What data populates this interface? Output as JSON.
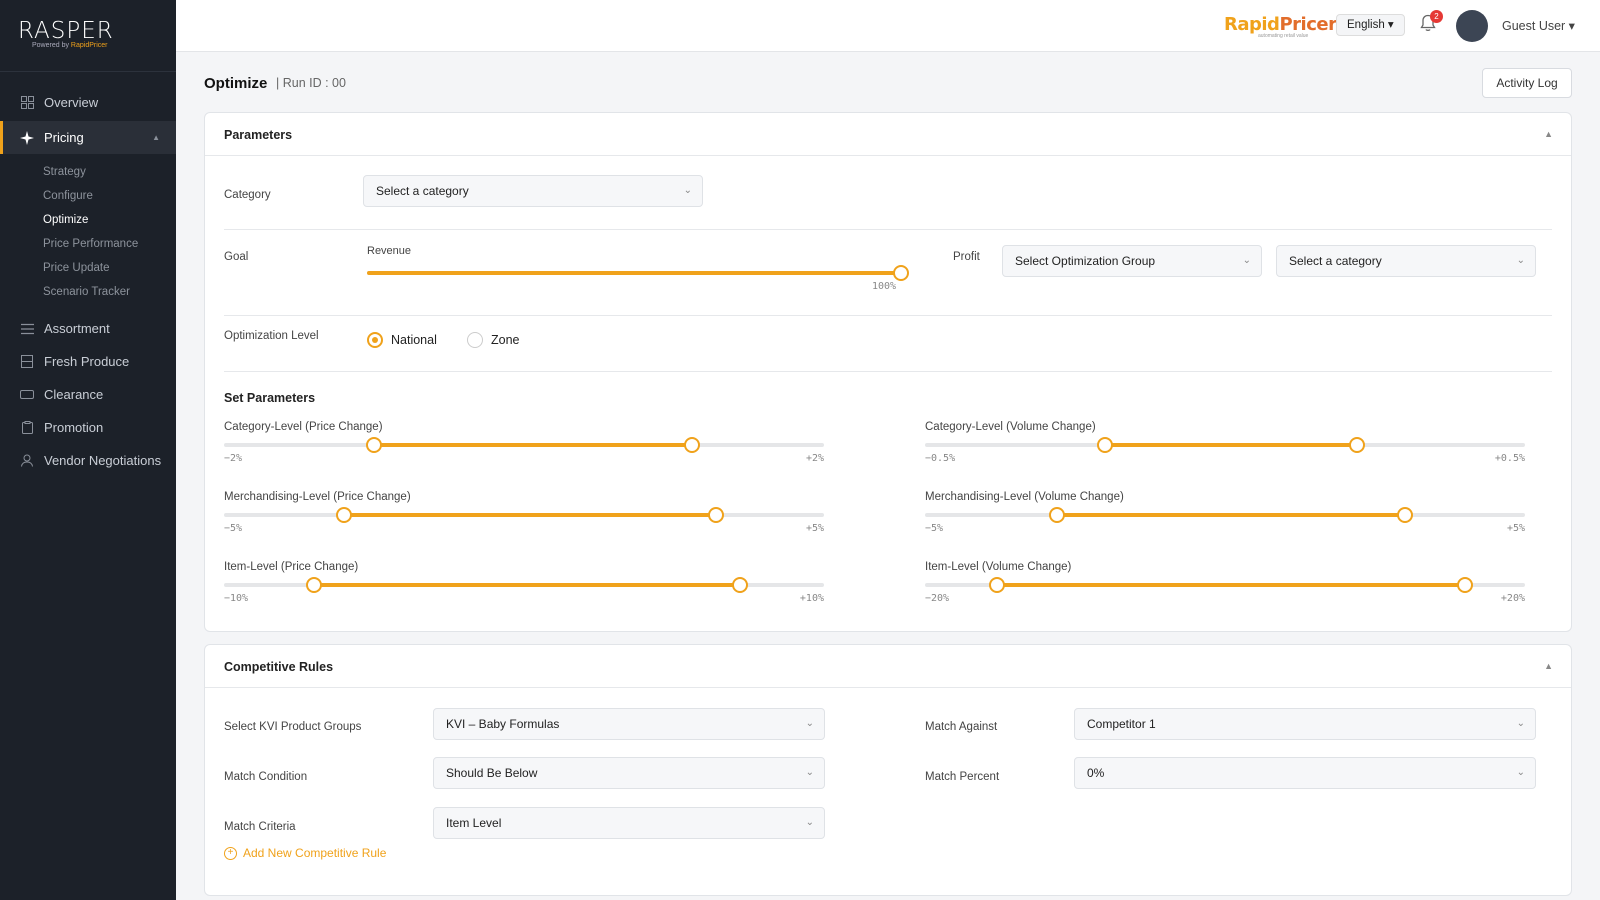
{
  "sidebar": {
    "logo": "RASPER",
    "logo_sub_prefix": "Powered by",
    "logo_sub_brand": "RapidPricer",
    "items": [
      {
        "label": "Overview"
      },
      {
        "label": "Pricing"
      },
      {
        "label": "Assortment"
      },
      {
        "label": "Fresh Produce"
      },
      {
        "label": "Clearance"
      },
      {
        "label": "Promotion"
      },
      {
        "label": "Vendor Negotiations"
      }
    ],
    "pricing_sub": [
      "Strategy",
      "Configure",
      "Optimize",
      "Price Performance",
      "Price Update",
      "Scenario Tracker"
    ],
    "active_sub": "Optimize"
  },
  "header": {
    "brand_a": "Rapid",
    "brand_b": "Pricer",
    "brand_tag": "automating retail value",
    "language": "English ▾",
    "notifications": "2",
    "user": "Guest User ▾"
  },
  "page": {
    "title": "Optimize",
    "run_id": "| Run ID : 00",
    "activity_log": "Activity Log"
  },
  "parameters": {
    "title": "Parameters",
    "category_label": "Category",
    "category_value": "Select a category",
    "goal_label": "Goal",
    "revenue_label": "Revenue",
    "revenue_value": "100%",
    "revenue_fraction": 1.0,
    "profit_label": "Profit",
    "opt_group": "Select Optimization Group",
    "profit_category": "Select a category",
    "level_label": "Optimization Level",
    "level_options": [
      "National",
      "Zone"
    ],
    "level_selected": "National",
    "set_parameters": "Set Parameters",
    "sliders": [
      {
        "label": "Category-Level (Price Change)",
        "min": "−2%",
        "max": "+2%",
        "low": 0.25,
        "high": 0.78
      },
      {
        "label": "Category-Level (Volume Change)",
        "min": "−0.5%",
        "max": "+0.5%",
        "low": 0.3,
        "high": 0.72
      },
      {
        "label": "Merchandising-Level (Price Change)",
        "min": "−5%",
        "max": "+5%",
        "low": 0.2,
        "high": 0.82
      },
      {
        "label": "Merchandising-Level (Volume Change)",
        "min": "−5%",
        "max": "+5%",
        "low": 0.22,
        "high": 0.8
      },
      {
        "label": "Item-Level (Price Change)",
        "min": "−10%",
        "max": "+10%",
        "low": 0.15,
        "high": 0.86
      },
      {
        "label": "Item-Level (Volume Change)",
        "min": "−20%",
        "max": "+20%",
        "low": 0.12,
        "high": 0.9
      }
    ]
  },
  "competitive": {
    "title": "Competitive Rules",
    "kvi_label": "Select KVI Product Groups",
    "kvi_value": "KVI – Baby Formulas",
    "match_against_label": "Match Against",
    "match_against_value": "Competitor 1",
    "condition_label": "Match Condition",
    "condition_value": "Should Be Below",
    "percent_label": "Match Percent",
    "percent_value": "0%",
    "criteria_label": "Match Criteria",
    "criteria_value": "Item Level",
    "add_rule": "Add New Competitive Rule"
  },
  "colors": {
    "accent": "#f0a21b",
    "sidebar": "#1c2129"
  }
}
